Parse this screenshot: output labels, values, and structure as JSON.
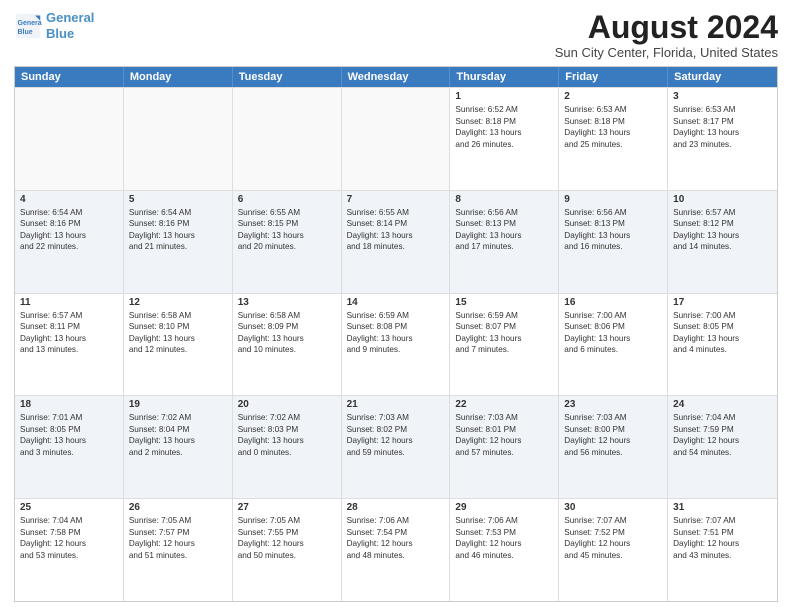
{
  "header": {
    "logo_line1": "General",
    "logo_line2": "Blue",
    "main_title": "August 2024",
    "subtitle": "Sun City Center, Florida, United States"
  },
  "calendar": {
    "days_of_week": [
      "Sunday",
      "Monday",
      "Tuesday",
      "Wednesday",
      "Thursday",
      "Friday",
      "Saturday"
    ],
    "rows": [
      [
        {
          "day": "",
          "info": "",
          "empty": true
        },
        {
          "day": "",
          "info": "",
          "empty": true
        },
        {
          "day": "",
          "info": "",
          "empty": true
        },
        {
          "day": "",
          "info": "",
          "empty": true
        },
        {
          "day": "1",
          "info": "Sunrise: 6:52 AM\nSunset: 8:18 PM\nDaylight: 13 hours\nand 26 minutes.",
          "empty": false
        },
        {
          "day": "2",
          "info": "Sunrise: 6:53 AM\nSunset: 8:18 PM\nDaylight: 13 hours\nand 25 minutes.",
          "empty": false
        },
        {
          "day": "3",
          "info": "Sunrise: 6:53 AM\nSunset: 8:17 PM\nDaylight: 13 hours\nand 23 minutes.",
          "empty": false
        }
      ],
      [
        {
          "day": "4",
          "info": "Sunrise: 6:54 AM\nSunset: 8:16 PM\nDaylight: 13 hours\nand 22 minutes.",
          "empty": false,
          "shaded": true
        },
        {
          "day": "5",
          "info": "Sunrise: 6:54 AM\nSunset: 8:16 PM\nDaylight: 13 hours\nand 21 minutes.",
          "empty": false,
          "shaded": true
        },
        {
          "day": "6",
          "info": "Sunrise: 6:55 AM\nSunset: 8:15 PM\nDaylight: 13 hours\nand 20 minutes.",
          "empty": false,
          "shaded": true
        },
        {
          "day": "7",
          "info": "Sunrise: 6:55 AM\nSunset: 8:14 PM\nDaylight: 13 hours\nand 18 minutes.",
          "empty": false,
          "shaded": true
        },
        {
          "day": "8",
          "info": "Sunrise: 6:56 AM\nSunset: 8:13 PM\nDaylight: 13 hours\nand 17 minutes.",
          "empty": false,
          "shaded": true
        },
        {
          "day": "9",
          "info": "Sunrise: 6:56 AM\nSunset: 8:13 PM\nDaylight: 13 hours\nand 16 minutes.",
          "empty": false,
          "shaded": true
        },
        {
          "day": "10",
          "info": "Sunrise: 6:57 AM\nSunset: 8:12 PM\nDaylight: 13 hours\nand 14 minutes.",
          "empty": false,
          "shaded": true
        }
      ],
      [
        {
          "day": "11",
          "info": "Sunrise: 6:57 AM\nSunset: 8:11 PM\nDaylight: 13 hours\nand 13 minutes.",
          "empty": false
        },
        {
          "day": "12",
          "info": "Sunrise: 6:58 AM\nSunset: 8:10 PM\nDaylight: 13 hours\nand 12 minutes.",
          "empty": false
        },
        {
          "day": "13",
          "info": "Sunrise: 6:58 AM\nSunset: 8:09 PM\nDaylight: 13 hours\nand 10 minutes.",
          "empty": false
        },
        {
          "day": "14",
          "info": "Sunrise: 6:59 AM\nSunset: 8:08 PM\nDaylight: 13 hours\nand 9 minutes.",
          "empty": false
        },
        {
          "day": "15",
          "info": "Sunrise: 6:59 AM\nSunset: 8:07 PM\nDaylight: 13 hours\nand 7 minutes.",
          "empty": false
        },
        {
          "day": "16",
          "info": "Sunrise: 7:00 AM\nSunset: 8:06 PM\nDaylight: 13 hours\nand 6 minutes.",
          "empty": false
        },
        {
          "day": "17",
          "info": "Sunrise: 7:00 AM\nSunset: 8:05 PM\nDaylight: 13 hours\nand 4 minutes.",
          "empty": false
        }
      ],
      [
        {
          "day": "18",
          "info": "Sunrise: 7:01 AM\nSunset: 8:05 PM\nDaylight: 13 hours\nand 3 minutes.",
          "empty": false,
          "shaded": true
        },
        {
          "day": "19",
          "info": "Sunrise: 7:02 AM\nSunset: 8:04 PM\nDaylight: 13 hours\nand 2 minutes.",
          "empty": false,
          "shaded": true
        },
        {
          "day": "20",
          "info": "Sunrise: 7:02 AM\nSunset: 8:03 PM\nDaylight: 13 hours\nand 0 minutes.",
          "empty": false,
          "shaded": true
        },
        {
          "day": "21",
          "info": "Sunrise: 7:03 AM\nSunset: 8:02 PM\nDaylight: 12 hours\nand 59 minutes.",
          "empty": false,
          "shaded": true
        },
        {
          "day": "22",
          "info": "Sunrise: 7:03 AM\nSunset: 8:01 PM\nDaylight: 12 hours\nand 57 minutes.",
          "empty": false,
          "shaded": true
        },
        {
          "day": "23",
          "info": "Sunrise: 7:03 AM\nSunset: 8:00 PM\nDaylight: 12 hours\nand 56 minutes.",
          "empty": false,
          "shaded": true
        },
        {
          "day": "24",
          "info": "Sunrise: 7:04 AM\nSunset: 7:59 PM\nDaylight: 12 hours\nand 54 minutes.",
          "empty": false,
          "shaded": true
        }
      ],
      [
        {
          "day": "25",
          "info": "Sunrise: 7:04 AM\nSunset: 7:58 PM\nDaylight: 12 hours\nand 53 minutes.",
          "empty": false
        },
        {
          "day": "26",
          "info": "Sunrise: 7:05 AM\nSunset: 7:57 PM\nDaylight: 12 hours\nand 51 minutes.",
          "empty": false
        },
        {
          "day": "27",
          "info": "Sunrise: 7:05 AM\nSunset: 7:55 PM\nDaylight: 12 hours\nand 50 minutes.",
          "empty": false
        },
        {
          "day": "28",
          "info": "Sunrise: 7:06 AM\nSunset: 7:54 PM\nDaylight: 12 hours\nand 48 minutes.",
          "empty": false
        },
        {
          "day": "29",
          "info": "Sunrise: 7:06 AM\nSunset: 7:53 PM\nDaylight: 12 hours\nand 46 minutes.",
          "empty": false
        },
        {
          "day": "30",
          "info": "Sunrise: 7:07 AM\nSunset: 7:52 PM\nDaylight: 12 hours\nand 45 minutes.",
          "empty": false
        },
        {
          "day": "31",
          "info": "Sunrise: 7:07 AM\nSunset: 7:51 PM\nDaylight: 12 hours\nand 43 minutes.",
          "empty": false
        }
      ]
    ]
  }
}
